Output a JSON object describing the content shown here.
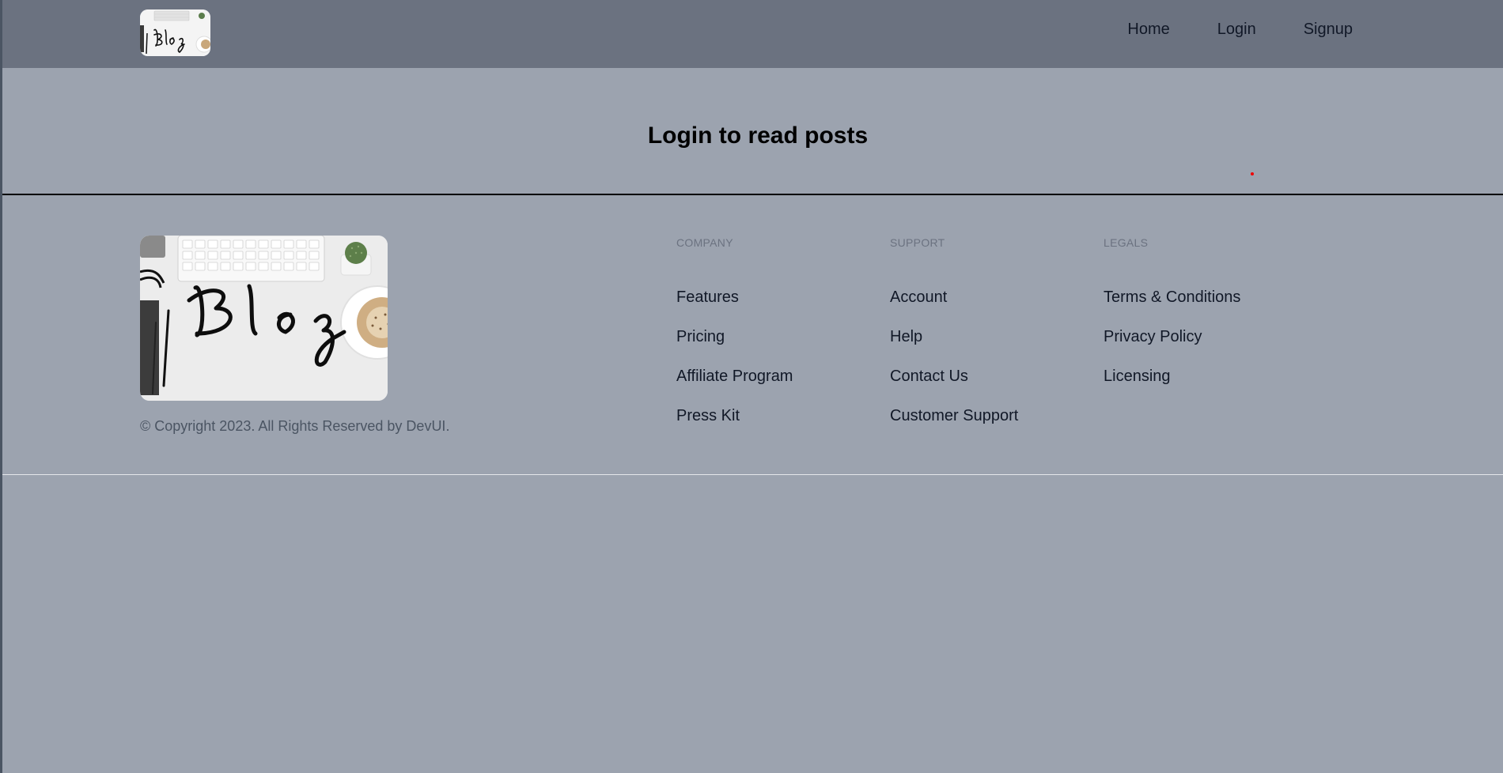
{
  "navbar": {
    "logo_text": "Blog",
    "links": [
      "Home",
      "Login",
      "Signup"
    ]
  },
  "main": {
    "message": "Login to read posts"
  },
  "footer": {
    "logo_text": "Blog",
    "copyright": "© Copyright 2023. All Rights Reserved by DevUI.",
    "columns": [
      {
        "heading": "COMPANY",
        "links": [
          "Features",
          "Pricing",
          "Affiliate Program",
          "Press Kit"
        ]
      },
      {
        "heading": "SUPPORT",
        "links": [
          "Account",
          "Help",
          "Contact Us",
          "Customer Support"
        ]
      },
      {
        "heading": "LEGALS",
        "links": [
          "Terms & Conditions",
          "Privacy Policy",
          "Licensing"
        ]
      }
    ]
  },
  "colors": {
    "navbar_bg": "#6b7280",
    "page_bg": "#9ca3af",
    "indicator_dot": "#ef0000"
  }
}
